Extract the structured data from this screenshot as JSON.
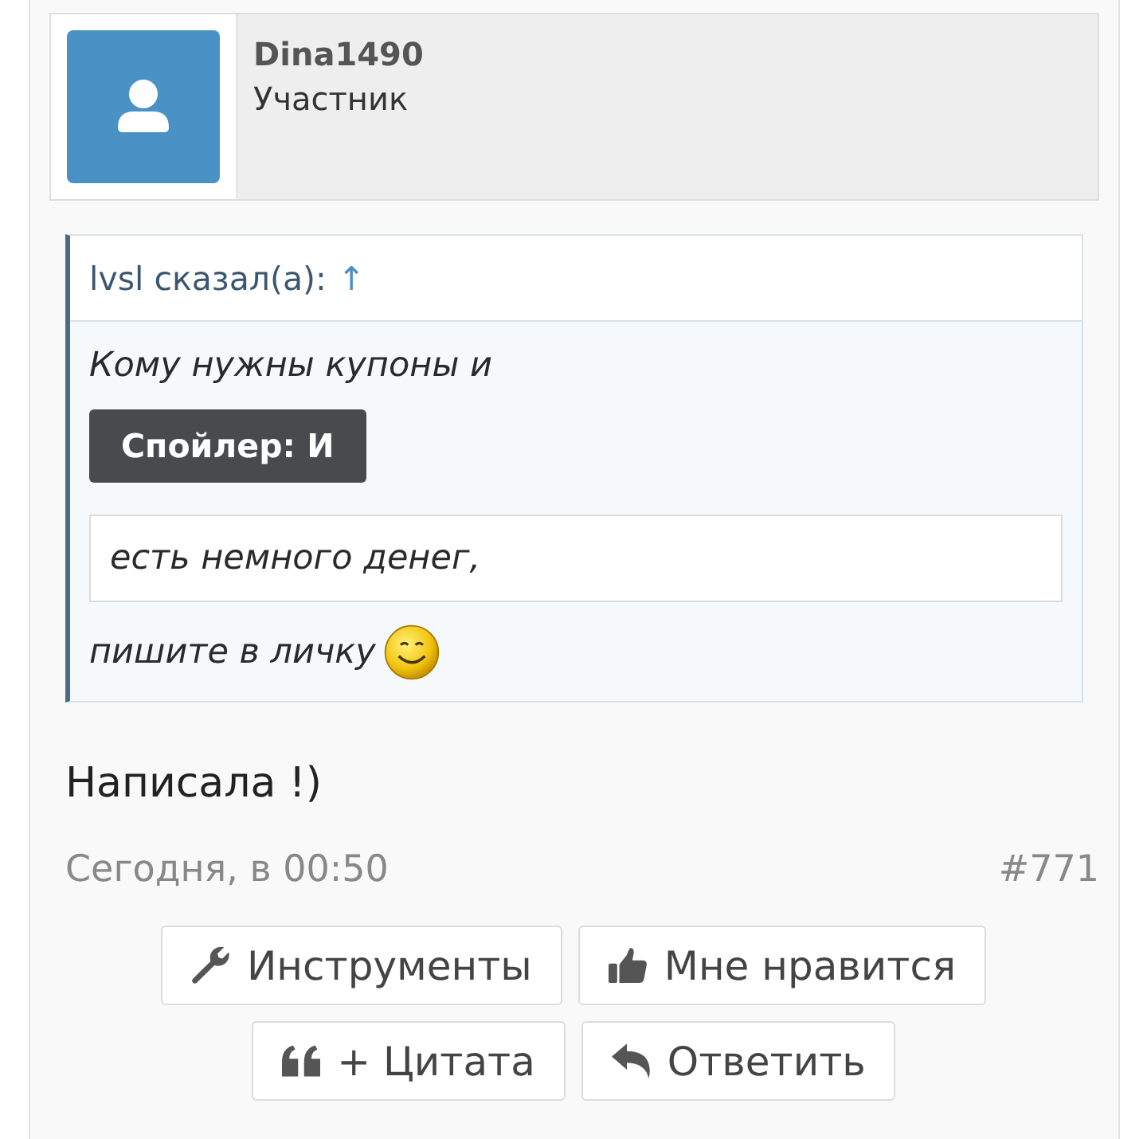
{
  "author": {
    "name": "Dina1490",
    "role": "Участник"
  },
  "quote": {
    "attribution": "lvsl сказал(а):",
    "jump_link": "↑",
    "body": [
      {
        "kind": "text",
        "text": "Кому нужны купоны и"
      },
      {
        "kind": "spoiler_button",
        "text": "Спойлер: И"
      },
      {
        "kind": "spoiler_content",
        "text": "есть немного денег,"
      },
      {
        "kind": "text",
        "text": "пишите в личку",
        "smiley": true
      }
    ]
  },
  "message": "Написала !)",
  "meta": {
    "date": "Сегодня, в 00:50",
    "post_number": "#771"
  },
  "actions": [
    {
      "kind": "tools",
      "label": "Инструменты"
    },
    {
      "kind": "like",
      "label": "Мне нравится"
    },
    {
      "kind": "quote",
      "label": "+ Цитата"
    },
    {
      "kind": "reply",
      "label": "Ответить"
    }
  ]
}
